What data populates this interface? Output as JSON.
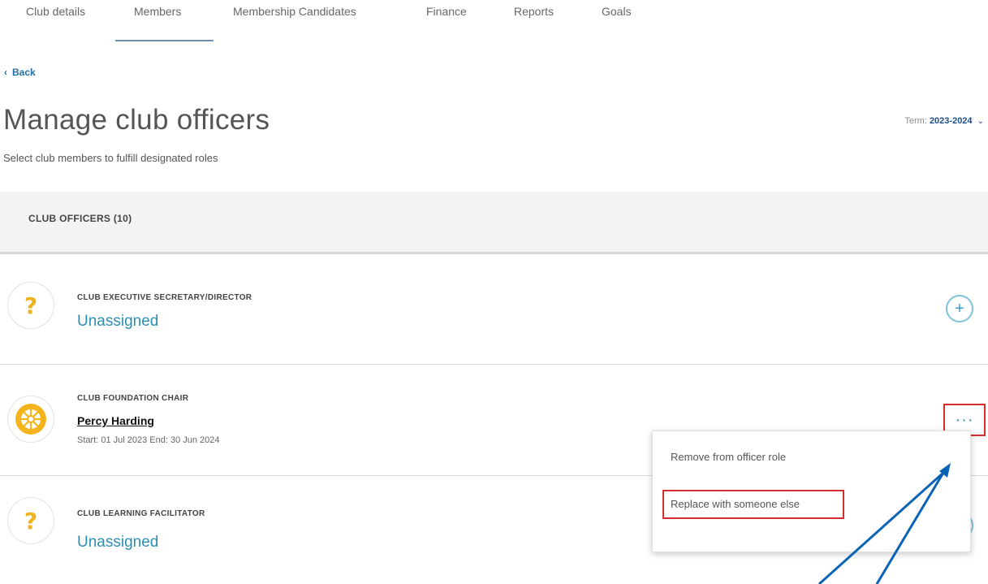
{
  "tabs": [
    {
      "label": "Club details"
    },
    {
      "label": "Members"
    },
    {
      "label": "Membership Candidates"
    },
    {
      "label": "Finance"
    },
    {
      "label": "Reports"
    },
    {
      "label": "Goals"
    }
  ],
  "back_label": "Back",
  "page_title": "Manage club officers",
  "subtitle": "Select club members to fulfill designated roles",
  "term": {
    "label": "Term:",
    "value": "2023-2024"
  },
  "section": {
    "title": "CLUB OFFICERS (10)"
  },
  "officers": [
    {
      "role": "CLUB EXECUTIVE SECRETARY/DIRECTOR",
      "status": "Unassigned",
      "icon": "question-icon"
    },
    {
      "role": "CLUB FOUNDATION CHAIR",
      "name": "Percy Harding",
      "dates": "Start: 01 Jul 2023 End: 30 Jun 2024",
      "icon": "rotary-wheel-icon"
    },
    {
      "role": "CLUB LEARNING FACILITATOR",
      "status": "Unassigned",
      "icon": "question-icon"
    }
  ],
  "menu": {
    "items": [
      {
        "label": "Remove from officer role"
      },
      {
        "label": "Replace with someone else"
      }
    ]
  },
  "colors": {
    "accent": "#2b8fb5",
    "highlight": "#d32f2f",
    "arrow": "#0b63b5",
    "question": "#f0b21c"
  }
}
